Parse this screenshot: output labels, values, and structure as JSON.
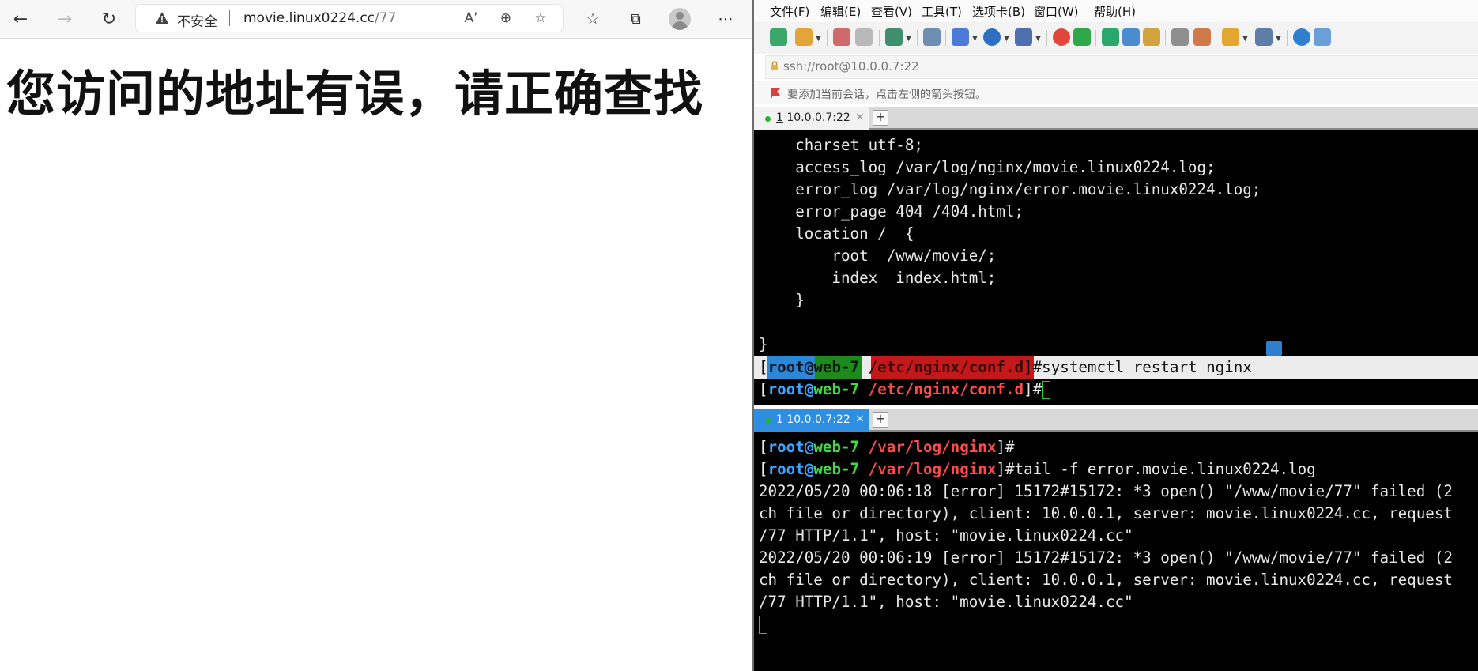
{
  "browser": {
    "nav": {
      "back_icon": "arrow-left-icon",
      "forward_icon": "arrow-right-icon",
      "reload_icon": "reload-icon"
    },
    "address": {
      "insecure_label": "不安全",
      "url_host": "movie.linux0224.cc",
      "url_path": "/77"
    },
    "page": {
      "heading": "您访问的地址有误，请正确查找"
    }
  },
  "ssh_client": {
    "menu": [
      "文件(F)",
      "编辑(E)",
      "查看(V)",
      "工具(T)",
      "选项卡(B)",
      "窗口(W)",
      "帮助(H)"
    ],
    "address": "ssh://root@10.0.0.7:22",
    "hint": "要添加当前会话，点击左侧的箭头按钮。",
    "pane_top": {
      "tab": {
        "index": "1",
        "label": " 10.0.0.7:22",
        "close": "×",
        "add": "+"
      },
      "config_lines": [
        "    charset utf-8;",
        "    access_log /var/log/nginx/movie.linux0224.log;",
        "    error_log /var/log/nginx/error.movie.linux0224.log;",
        "    error_page 404 /404.html;",
        "    location /  {",
        "        root  /www/movie/;",
        "        index  index.html;",
        "    }",
        "",
        "}"
      ],
      "prompt_user": "root",
      "prompt_at": "@",
      "prompt_host": "web-7",
      "prompt_path": "/etc/nginx/conf.d",
      "prompt_open": "[",
      "prompt_close": "]#",
      "command": "systemctl restart nginx"
    },
    "pane_bottom": {
      "tab": {
        "index": "1",
        "label": " 10.0.0.7:22",
        "close": "×",
        "add": "+"
      },
      "prompt_user": "root",
      "prompt_at": "@",
      "prompt_host": "web-7",
      "prompt_path": "/var/log/nginx",
      "prompt_open": "[",
      "prompt_close": "]#",
      "command": "tail -f error.movie.linux0224.log",
      "log_lines": [
        "2022/05/20 00:06:18 [error] 15172#15172: *3 open() \"/www/movie/77\" failed (2",
        "ch file or directory), client: 10.0.0.1, server: movie.linux0224.cc, request",
        "/77 HTTP/1.1\", host: \"movie.linux0224.cc\"",
        "2022/05/20 00:06:19 [error] 15172#15172: *3 open() \"/www/movie/77\" failed (2",
        "ch file or directory), client: 10.0.0.1, server: movie.linux0224.cc, request",
        "/77 HTTP/1.1\", host: \"movie.linux0224.cc\""
      ]
    }
  },
  "colors": {
    "prompt_user": "#3aa6ff",
    "prompt_host": "#3fdc3f",
    "prompt_path": "#ff4a4a",
    "tab_active": "#2d8ee2"
  }
}
